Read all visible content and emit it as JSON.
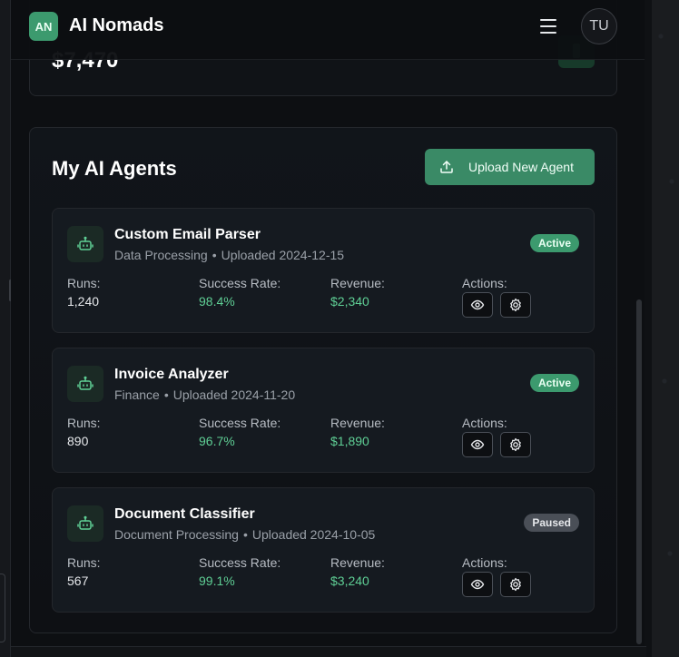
{
  "header": {
    "logo_text": "AN",
    "brand": "AI Nomads",
    "avatar_initials": "TU"
  },
  "stat": {
    "value": "$7,470"
  },
  "agents": {
    "title": "My AI Agents",
    "upload_label": "Upload New Agent",
    "labels": {
      "runs": "Runs:",
      "success": "Success Rate:",
      "revenue": "Revenue:",
      "actions": "Actions:"
    },
    "items": [
      {
        "name": "Custom Email Parser",
        "category": "Data Processing",
        "uploaded": "Uploaded 2024-12-15",
        "status": "Active",
        "runs": "1,240",
        "success_rate": "98.4%",
        "revenue": "$2,340"
      },
      {
        "name": "Invoice Analyzer",
        "category": "Finance",
        "uploaded": "Uploaded 2024-11-20",
        "status": "Active",
        "runs": "890",
        "success_rate": "96.7%",
        "revenue": "$1,890"
      },
      {
        "name": "Document Classifier",
        "category": "Document Processing",
        "uploaded": "Uploaded 2024-10-05",
        "status": "Paused",
        "runs": "567",
        "success_rate": "99.1%",
        "revenue": "$3,240"
      }
    ]
  },
  "colors": {
    "accent": "#3c9a6e",
    "positive_text": "#5fcf95",
    "paused": "#4a4f57"
  },
  "icons": {
    "agent": "robot-icon",
    "upload": "upload-icon",
    "view": "eye-icon",
    "settings": "gear-icon",
    "menu": "hamburger-menu-icon"
  }
}
